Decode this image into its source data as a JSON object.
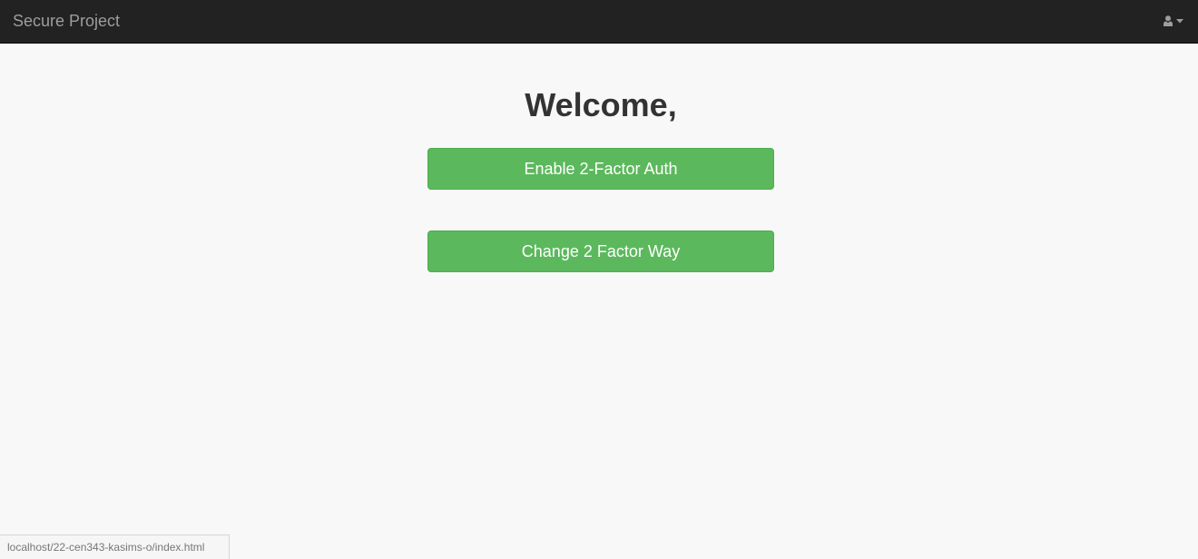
{
  "navbar": {
    "brand": "Secure Project",
    "user_icon": "user-icon",
    "caret_icon": "caret-down-icon",
    "background": "#222222",
    "brand_color": "#9d9d9d"
  },
  "main": {
    "title": "Welcome,",
    "buttons": [
      {
        "label": "Enable 2-Factor Auth"
      },
      {
        "label": "Change 2 Factor Way"
      }
    ],
    "button_color": "#5cb85c"
  },
  "status_bar": {
    "url": "localhost/22-cen343-kasims-o/index.html"
  }
}
